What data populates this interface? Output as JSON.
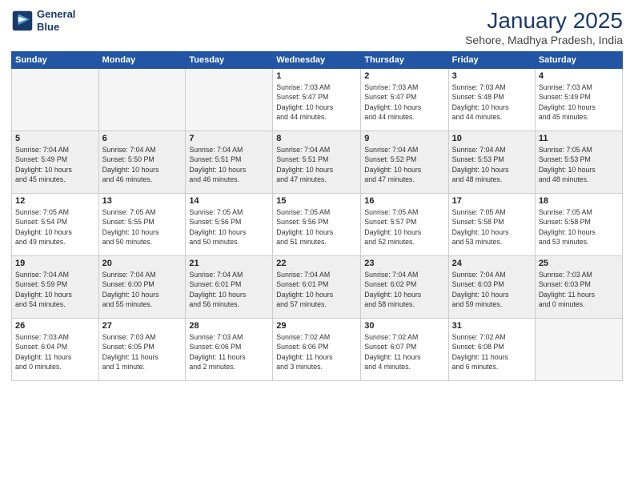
{
  "header": {
    "logo_line1": "General",
    "logo_line2": "Blue",
    "month": "January 2025",
    "location": "Sehore, Madhya Pradesh, India"
  },
  "days_of_week": [
    "Sunday",
    "Monday",
    "Tuesday",
    "Wednesday",
    "Thursday",
    "Friday",
    "Saturday"
  ],
  "weeks": [
    {
      "shaded": false,
      "days": [
        {
          "num": "",
          "info": ""
        },
        {
          "num": "",
          "info": ""
        },
        {
          "num": "",
          "info": ""
        },
        {
          "num": "1",
          "info": "Sunrise: 7:03 AM\nSunset: 5:47 PM\nDaylight: 10 hours\nand 44 minutes."
        },
        {
          "num": "2",
          "info": "Sunrise: 7:03 AM\nSunset: 5:47 PM\nDaylight: 10 hours\nand 44 minutes."
        },
        {
          "num": "3",
          "info": "Sunrise: 7:03 AM\nSunset: 5:48 PM\nDaylight: 10 hours\nand 44 minutes."
        },
        {
          "num": "4",
          "info": "Sunrise: 7:03 AM\nSunset: 5:49 PM\nDaylight: 10 hours\nand 45 minutes."
        }
      ]
    },
    {
      "shaded": true,
      "days": [
        {
          "num": "5",
          "info": "Sunrise: 7:04 AM\nSunset: 5:49 PM\nDaylight: 10 hours\nand 45 minutes."
        },
        {
          "num": "6",
          "info": "Sunrise: 7:04 AM\nSunset: 5:50 PM\nDaylight: 10 hours\nand 46 minutes."
        },
        {
          "num": "7",
          "info": "Sunrise: 7:04 AM\nSunset: 5:51 PM\nDaylight: 10 hours\nand 46 minutes."
        },
        {
          "num": "8",
          "info": "Sunrise: 7:04 AM\nSunset: 5:51 PM\nDaylight: 10 hours\nand 47 minutes."
        },
        {
          "num": "9",
          "info": "Sunrise: 7:04 AM\nSunset: 5:52 PM\nDaylight: 10 hours\nand 47 minutes."
        },
        {
          "num": "10",
          "info": "Sunrise: 7:04 AM\nSunset: 5:53 PM\nDaylight: 10 hours\nand 48 minutes."
        },
        {
          "num": "11",
          "info": "Sunrise: 7:05 AM\nSunset: 5:53 PM\nDaylight: 10 hours\nand 48 minutes."
        }
      ]
    },
    {
      "shaded": false,
      "days": [
        {
          "num": "12",
          "info": "Sunrise: 7:05 AM\nSunset: 5:54 PM\nDaylight: 10 hours\nand 49 minutes."
        },
        {
          "num": "13",
          "info": "Sunrise: 7:05 AM\nSunset: 5:55 PM\nDaylight: 10 hours\nand 50 minutes."
        },
        {
          "num": "14",
          "info": "Sunrise: 7:05 AM\nSunset: 5:56 PM\nDaylight: 10 hours\nand 50 minutes."
        },
        {
          "num": "15",
          "info": "Sunrise: 7:05 AM\nSunset: 5:56 PM\nDaylight: 10 hours\nand 51 minutes."
        },
        {
          "num": "16",
          "info": "Sunrise: 7:05 AM\nSunset: 5:57 PM\nDaylight: 10 hours\nand 52 minutes."
        },
        {
          "num": "17",
          "info": "Sunrise: 7:05 AM\nSunset: 5:58 PM\nDaylight: 10 hours\nand 53 minutes."
        },
        {
          "num": "18",
          "info": "Sunrise: 7:05 AM\nSunset: 5:58 PM\nDaylight: 10 hours\nand 53 minutes."
        }
      ]
    },
    {
      "shaded": true,
      "days": [
        {
          "num": "19",
          "info": "Sunrise: 7:04 AM\nSunset: 5:59 PM\nDaylight: 10 hours\nand 54 minutes."
        },
        {
          "num": "20",
          "info": "Sunrise: 7:04 AM\nSunset: 6:00 PM\nDaylight: 10 hours\nand 55 minutes."
        },
        {
          "num": "21",
          "info": "Sunrise: 7:04 AM\nSunset: 6:01 PM\nDaylight: 10 hours\nand 56 minutes."
        },
        {
          "num": "22",
          "info": "Sunrise: 7:04 AM\nSunset: 6:01 PM\nDaylight: 10 hours\nand 57 minutes."
        },
        {
          "num": "23",
          "info": "Sunrise: 7:04 AM\nSunset: 6:02 PM\nDaylight: 10 hours\nand 58 minutes."
        },
        {
          "num": "24",
          "info": "Sunrise: 7:04 AM\nSunset: 6:03 PM\nDaylight: 10 hours\nand 59 minutes."
        },
        {
          "num": "25",
          "info": "Sunrise: 7:03 AM\nSunset: 6:03 PM\nDaylight: 11 hours\nand 0 minutes."
        }
      ]
    },
    {
      "shaded": false,
      "days": [
        {
          "num": "26",
          "info": "Sunrise: 7:03 AM\nSunset: 6:04 PM\nDaylight: 11 hours\nand 0 minutes."
        },
        {
          "num": "27",
          "info": "Sunrise: 7:03 AM\nSunset: 6:05 PM\nDaylight: 11 hours\nand 1 minute."
        },
        {
          "num": "28",
          "info": "Sunrise: 7:03 AM\nSunset: 6:06 PM\nDaylight: 11 hours\nand 2 minutes."
        },
        {
          "num": "29",
          "info": "Sunrise: 7:02 AM\nSunset: 6:06 PM\nDaylight: 11 hours\nand 3 minutes."
        },
        {
          "num": "30",
          "info": "Sunrise: 7:02 AM\nSunset: 6:07 PM\nDaylight: 11 hours\nand 4 minutes."
        },
        {
          "num": "31",
          "info": "Sunrise: 7:02 AM\nSunset: 6:08 PM\nDaylight: 11 hours\nand 6 minutes."
        },
        {
          "num": "",
          "info": ""
        }
      ]
    }
  ]
}
